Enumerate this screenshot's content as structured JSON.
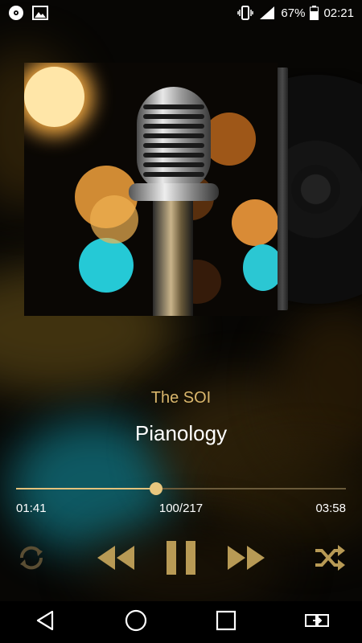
{
  "status_bar": {
    "left_icons": [
      "cd-icon",
      "image-icon"
    ],
    "right_icons": [
      "vibrate-icon",
      "signal-icon",
      "battery-icon"
    ],
    "battery": "67%",
    "time": "02:21"
  },
  "now_playing": {
    "artist": "The SOI",
    "title": "Pianology",
    "elapsed": "01:41",
    "track_position": "100/217",
    "duration": "03:58",
    "progress_fraction": 0.424
  },
  "controls": {
    "icons": [
      "repeat-icon",
      "previous-icon",
      "pause-icon",
      "next-icon",
      "shuffle-icon"
    ]
  },
  "navigation_bar": {
    "icons": [
      "back-icon",
      "home-icon",
      "recents-icon",
      "screen-mirror-icon"
    ]
  },
  "colors": {
    "accent": "#d9b66c",
    "control_icons": "#b89a55",
    "repeat_icon": "#5a4e33",
    "progress_track": "#6a5a3a"
  }
}
